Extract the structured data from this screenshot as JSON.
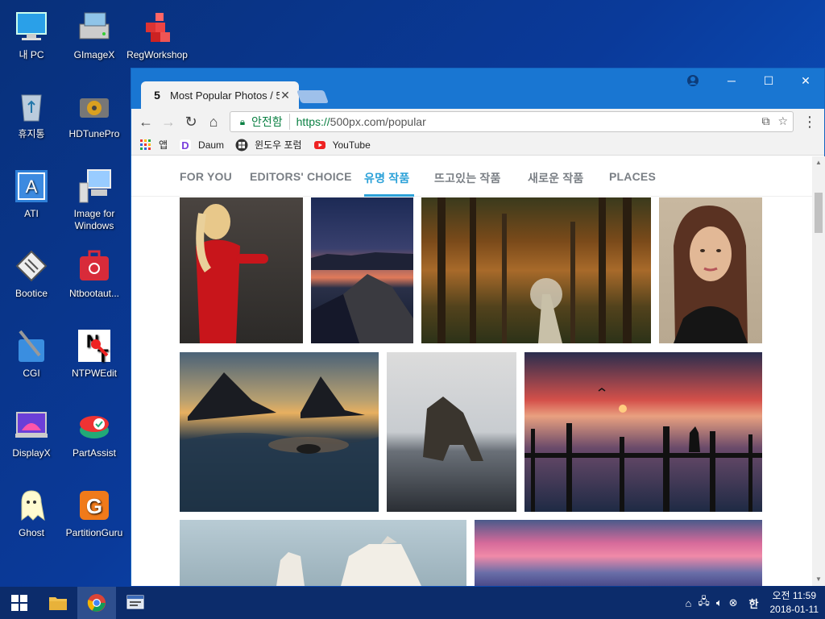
{
  "desktop": {
    "icons": [
      {
        "label": "내 PC",
        "icon": "computer-icon"
      },
      {
        "label": "GImageX",
        "icon": "gimagex-icon"
      },
      {
        "label": "RegWorkshop",
        "icon": "regworkshop-icon"
      },
      {
        "label": "휴지통",
        "icon": "recycle-bin-icon"
      },
      {
        "label": "HDTunePro",
        "icon": "hdtune-icon"
      },
      {
        "label": "ATI",
        "icon": "ati-icon"
      },
      {
        "label": "Image for Windows",
        "icon": "image-for-windows-icon"
      },
      {
        "label": "Bootice",
        "icon": "bootice-icon"
      },
      {
        "label": "Ntbootaut...",
        "icon": "ntbootautofix-icon"
      },
      {
        "label": "CGI",
        "icon": "cgi-icon"
      },
      {
        "label": "NTPWEdit",
        "icon": "ntpwedit-icon"
      },
      {
        "label": "DisplayX",
        "icon": "displayx-icon"
      },
      {
        "label": "PartAssist",
        "icon": "partassist-icon"
      },
      {
        "label": "Ghost",
        "icon": "ghost-icon"
      },
      {
        "label": "PartitionGuru",
        "icon": "partitionguru-icon"
      }
    ]
  },
  "browser": {
    "tab_title": "Most Popular Photos / 5",
    "secure_label": "안전함",
    "url_scheme": "https://",
    "url_rest": "500px.com/popular",
    "bookmarks": [
      {
        "label": "앱",
        "icon": "apps-grid-icon"
      },
      {
        "label": "Daum",
        "icon": "daum-icon"
      },
      {
        "label": "윈도우 포럼",
        "icon": "windows-forum-icon"
      },
      {
        "label": "YouTube",
        "icon": "youtube-icon"
      }
    ]
  },
  "site": {
    "nav": [
      "FOR YOU",
      "EDITORS' CHOICE",
      "유명 작품",
      "뜨고있는 작품",
      "새로운 작품",
      "PLACES"
    ],
    "active_nav": "유명 작품",
    "accent": "#2ba1d8"
  },
  "taskbar": {
    "ime": "한",
    "time": "오전 11:59",
    "date": "2018-01-11"
  }
}
